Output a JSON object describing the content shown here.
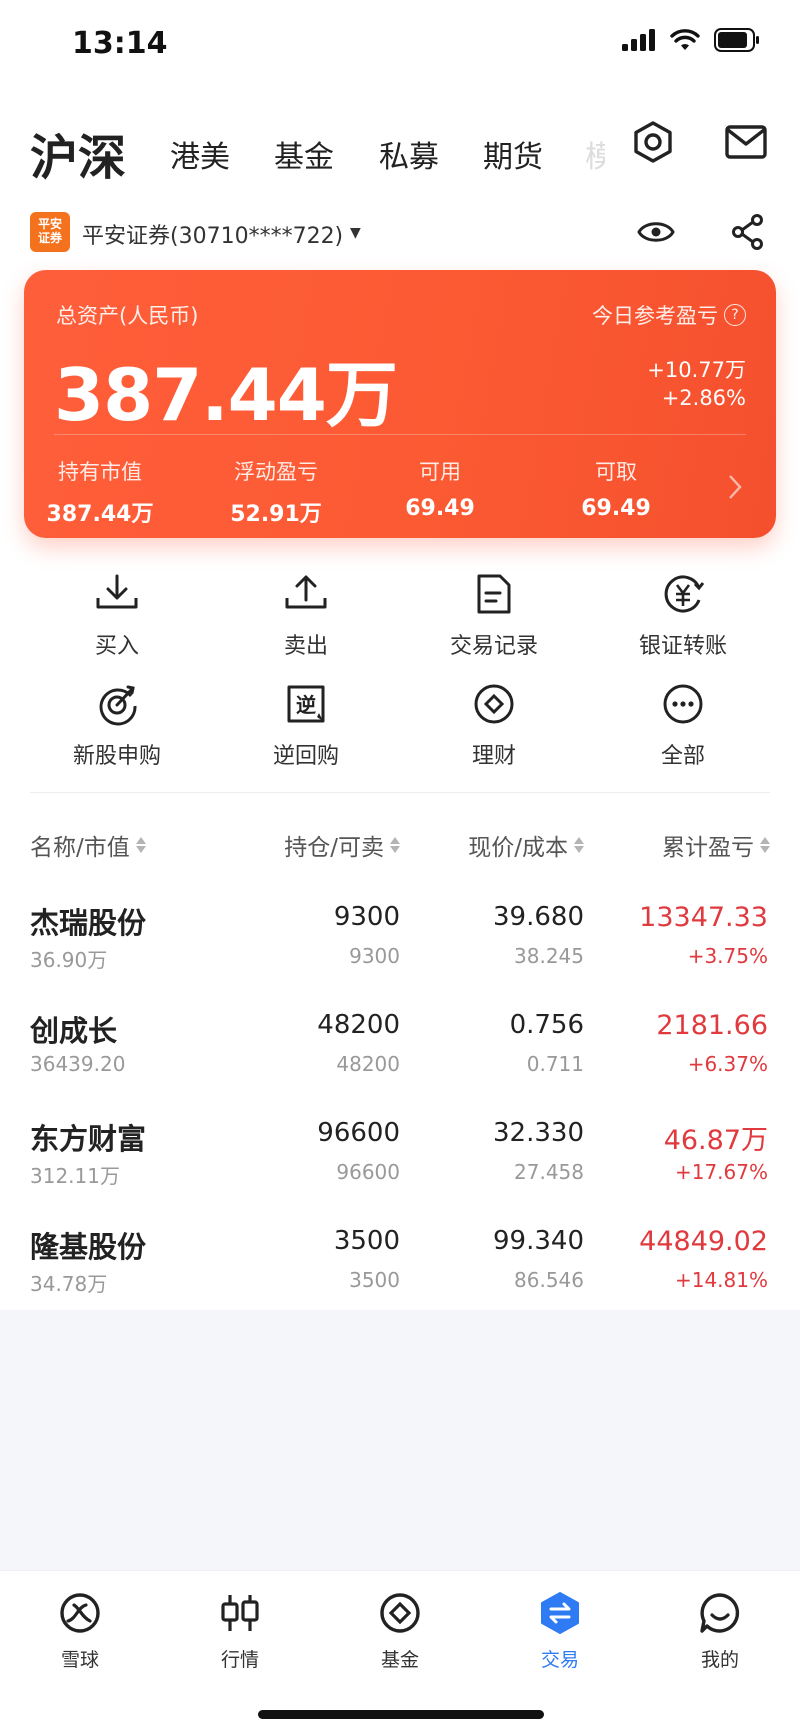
{
  "status_bar": {
    "time": "13:14"
  },
  "top_nav": {
    "tabs": [
      {
        "label": "沪深",
        "active": true
      },
      {
        "label": "港美"
      },
      {
        "label": "基金"
      },
      {
        "label": "私募"
      },
      {
        "label": "期货"
      },
      {
        "label": "模"
      }
    ],
    "icons": [
      "settings-hexagon-icon",
      "mail-icon"
    ]
  },
  "account": {
    "broker_logo_text": "平安证券",
    "name": "平安证券(30710****722)",
    "icons": [
      "eye-icon",
      "share-icon"
    ]
  },
  "asset_card": {
    "total_label": "总资产(人民币)",
    "total_value": "387.44万",
    "today_label": "今日参考盈亏",
    "today_amount": "+10.77万",
    "today_pct": "+2.86%",
    "stats": [
      {
        "label": "持有市值",
        "value": "387.44万"
      },
      {
        "label": "浮动盈亏",
        "value": "52.91万"
      },
      {
        "label": "可用",
        "value": "69.49"
      },
      {
        "label": "可取",
        "value": "69.49"
      }
    ],
    "colors": {
      "gradient_start": "#ff5e3a",
      "gradient_end": "#f5502e"
    }
  },
  "actions": [
    {
      "label": "买入",
      "icon": "buy-download-icon"
    },
    {
      "label": "卖出",
      "icon": "sell-upload-icon"
    },
    {
      "label": "交易记录",
      "icon": "document-icon"
    },
    {
      "label": "银证转账",
      "icon": "yuan-transfer-icon"
    },
    {
      "label": "新股申购",
      "icon": "target-icon"
    },
    {
      "label": "逆回购",
      "icon": "reverse-repo-icon"
    },
    {
      "label": "理财",
      "icon": "diamond-circle-icon"
    },
    {
      "label": "全部",
      "icon": "more-dots-icon"
    }
  ],
  "table": {
    "headers": [
      "名称/市值",
      "持仓/可卖",
      "现价/成本",
      "累计盈亏"
    ],
    "rows": [
      {
        "name": "杰瑞股份",
        "market_value": "36.90万",
        "position": "9300",
        "sellable": "9300",
        "price": "39.680",
        "cost": "38.245",
        "pl": "13347.33",
        "pl_pct": "+3.75%"
      },
      {
        "name": "创成长",
        "market_value": "36439.20",
        "position": "48200",
        "sellable": "48200",
        "price": "0.756",
        "cost": "0.711",
        "pl": "2181.66",
        "pl_pct": "+6.37%"
      },
      {
        "name": "东方财富",
        "market_value": "312.11万",
        "position": "96600",
        "sellable": "96600",
        "price": "32.330",
        "cost": "27.458",
        "pl": "46.87万",
        "pl_pct": "+17.67%"
      },
      {
        "name": "隆基股份",
        "market_value": "34.78万",
        "position": "3500",
        "sellable": "3500",
        "price": "99.340",
        "cost": "86.546",
        "pl": "44849.02",
        "pl_pct": "+14.81%"
      }
    ],
    "colors": {
      "profit": "#e0393e"
    }
  },
  "tabbar": {
    "tabs": [
      {
        "label": "雪球",
        "icon": "snowball-icon"
      },
      {
        "label": "行情",
        "icon": "candlestick-icon"
      },
      {
        "label": "基金",
        "icon": "fund-icon"
      },
      {
        "label": "交易",
        "icon": "trade-icon",
        "active": true
      },
      {
        "label": "我的",
        "icon": "profile-chat-icon"
      }
    ],
    "colors": {
      "active": "#2f7bf3"
    }
  }
}
